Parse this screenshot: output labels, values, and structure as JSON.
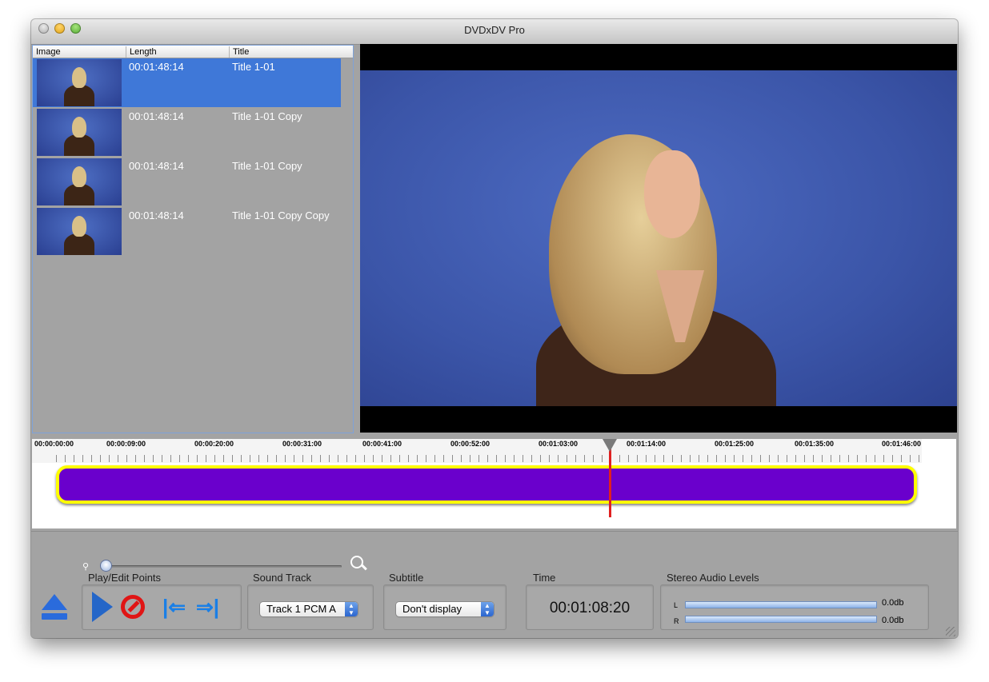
{
  "window": {
    "title": "DVDxDV Pro"
  },
  "table": {
    "headers": [
      "Image",
      "Length",
      "Title"
    ],
    "rows": [
      {
        "length": "00:01:48:14",
        "title": "Title 1-01",
        "selected": true
      },
      {
        "length": "00:01:48:14",
        "title": "Title 1-01 Copy",
        "selected": false
      },
      {
        "length": "00:01:48:14",
        "title": "Title 1-01 Copy",
        "selected": false
      },
      {
        "length": "00:01:48:14",
        "title": "Title 1-01 Copy Copy",
        "selected": false
      }
    ]
  },
  "timeline": {
    "labels": [
      "00:00:00:00",
      "00:00:09:00",
      "00:00:20:00",
      "00:00:31:00",
      "00:00:41:00",
      "00:00:52:00",
      "00:01:03:00",
      "00:01:14:00",
      "00:01:25:00",
      "00:01:35:00",
      "00:01:46:00"
    ],
    "clip_color": "#6a00cc",
    "clip_border_color": "#ffff00",
    "playhead_color": "#e02020"
  },
  "controls": {
    "play_edit_label": "Play/Edit Points",
    "sound_track_label": "Sound Track",
    "sound_track_value": "Track 1 PCM A",
    "subtitle_label": "Subtitle",
    "subtitle_value": "Don't display",
    "time_label": "Time",
    "time_value": "00:01:08:20",
    "audio_label": "Stereo Audio Levels",
    "left_channel": "L",
    "right_channel": "R",
    "left_level": "0.0db",
    "right_level": "0.0db"
  },
  "icons": {
    "eject": "eject-icon",
    "play": "play-icon",
    "stop": "stop-icon",
    "mark_in": "mark-in-icon",
    "mark_out": "mark-out-icon",
    "zoom_out": "zoom-out-icon",
    "zoom_in": "zoom-in-icon"
  }
}
